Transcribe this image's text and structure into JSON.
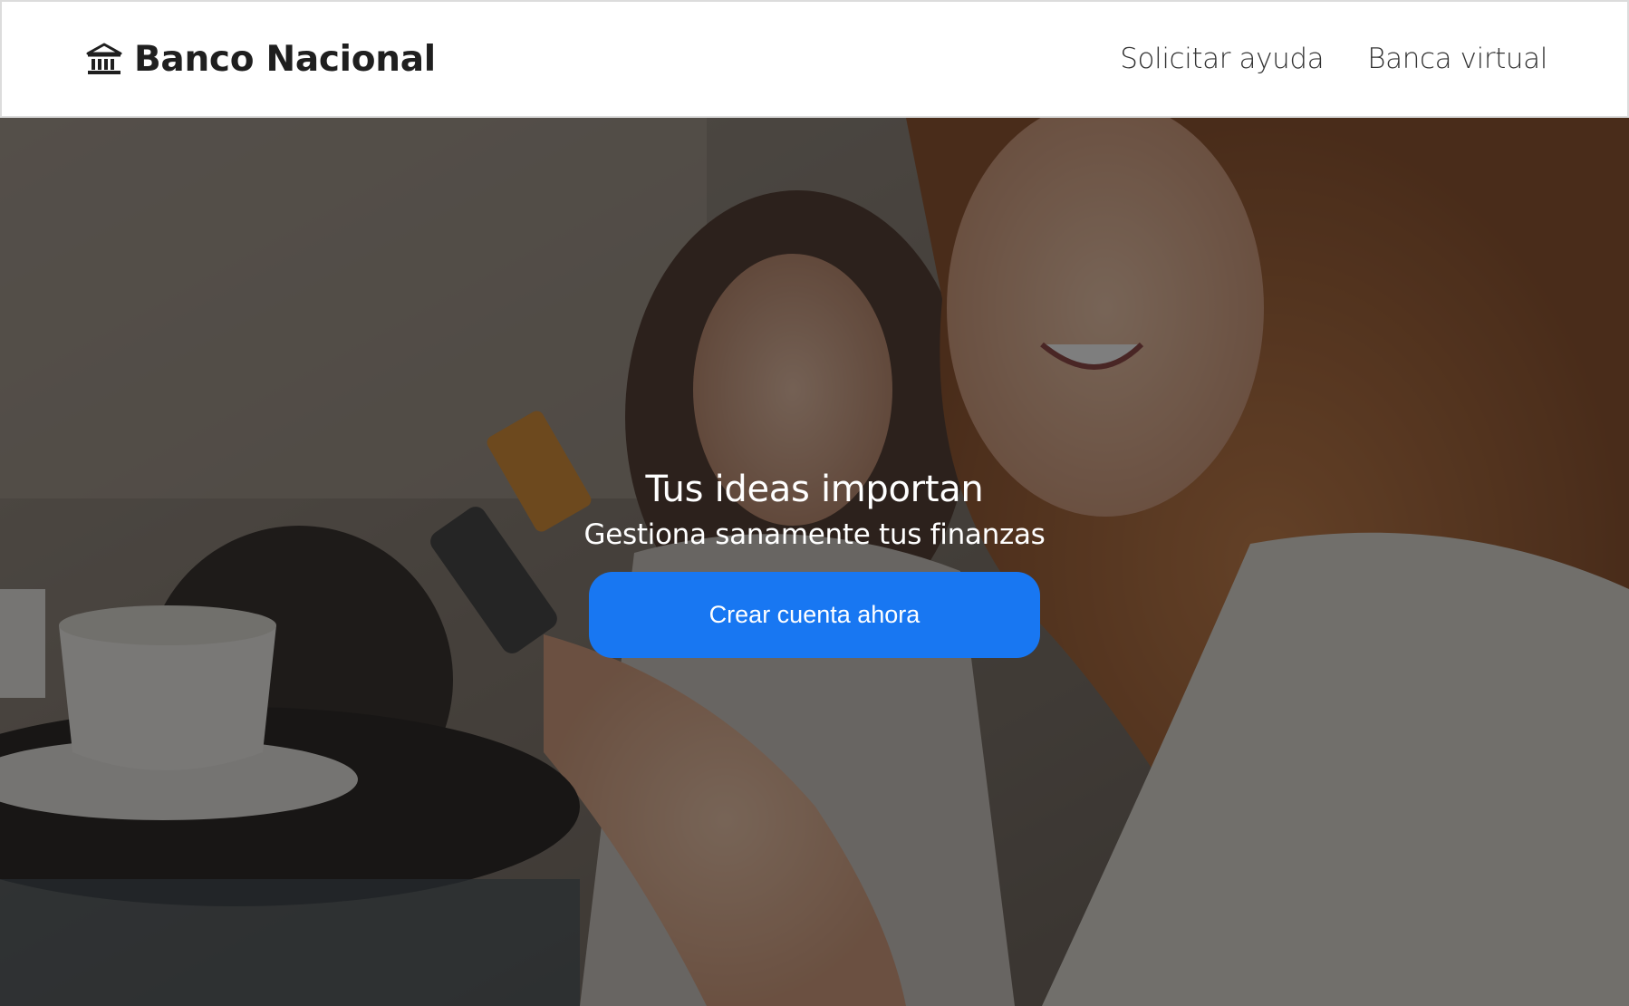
{
  "header": {
    "brand_icon": "bank-icon",
    "brand_name": "Banco Nacional",
    "nav": [
      {
        "label": "Solicitar ayuda"
      },
      {
        "label": "Banca virtual"
      }
    ]
  },
  "hero": {
    "background": "photo-two-women-laughing-with-phone-and-card",
    "title": "Tus ideas importan",
    "subtitle": "Gestiona sanamente tus finanzas",
    "cta_label": "Crear cuenta ahora"
  },
  "colors": {
    "accent": "#1877f2",
    "navbar_bg": "#ffffff",
    "text_dark": "#1f1f1f"
  }
}
